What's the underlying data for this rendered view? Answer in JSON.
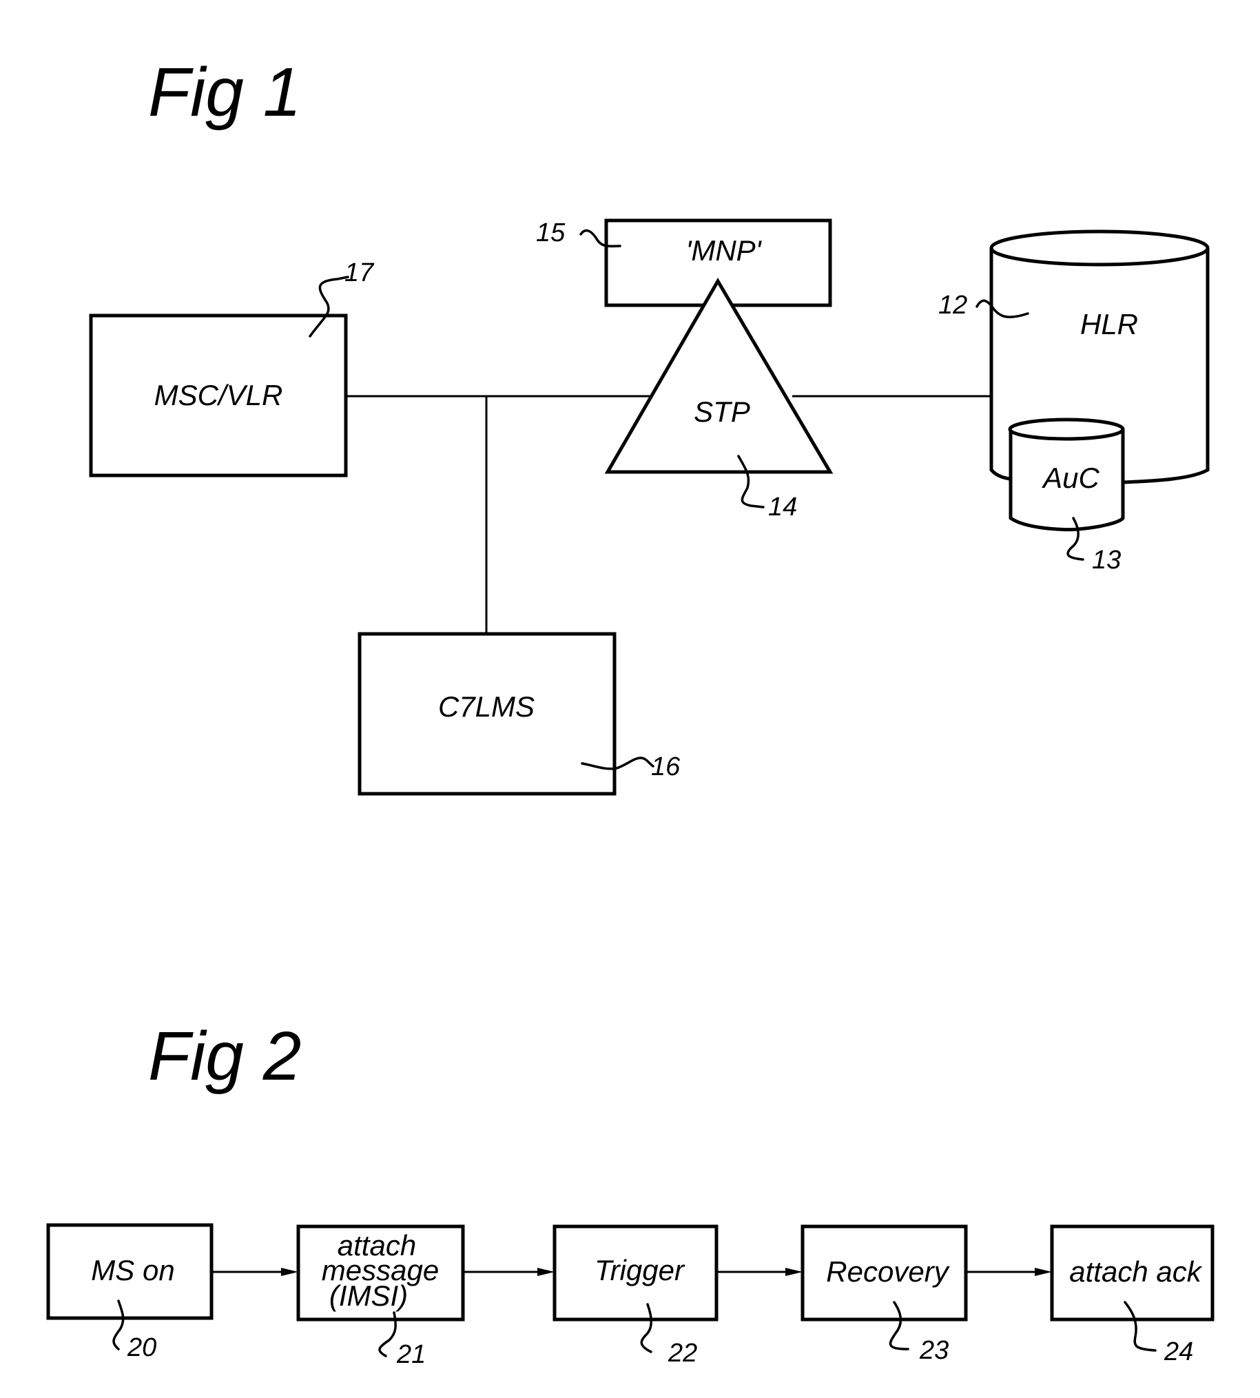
{
  "figures": [
    {
      "title": "Fig 1",
      "nodes": [
        {
          "id": "msc_vlr",
          "label": "MSC/VLR",
          "shape": "rectangle",
          "ref": "17"
        },
        {
          "id": "mnp",
          "label": "'MNP'",
          "shape": "rectangle",
          "ref": "15"
        },
        {
          "id": "stp",
          "label": "STP",
          "shape": "triangle",
          "ref": "14"
        },
        {
          "id": "hlr",
          "label": "HLR",
          "shape": "cylinder",
          "ref": "12"
        },
        {
          "id": "auc",
          "label": "AuC",
          "shape": "cylinder",
          "ref": "13"
        },
        {
          "id": "c7lms",
          "label": "C7LMS",
          "shape": "rectangle",
          "ref": "16"
        }
      ],
      "connections": [
        {
          "from": "msc_vlr",
          "to": "stp"
        },
        {
          "from": "stp",
          "to": "hlr"
        },
        {
          "from": "msc_vlr",
          "to": "c7lms"
        }
      ]
    },
    {
      "title": "Fig 2",
      "steps": [
        {
          "label_lines": [
            "MS on"
          ],
          "ref": "20"
        },
        {
          "label_lines": [
            "attach",
            "message",
            "(IMSI)"
          ],
          "ref": "21"
        },
        {
          "label_lines": [
            "Trigger"
          ],
          "ref": "22"
        },
        {
          "label_lines": [
            "Recovery"
          ],
          "ref": "23"
        },
        {
          "label_lines": [
            "attach ack"
          ],
          "ref": "24"
        }
      ]
    }
  ]
}
